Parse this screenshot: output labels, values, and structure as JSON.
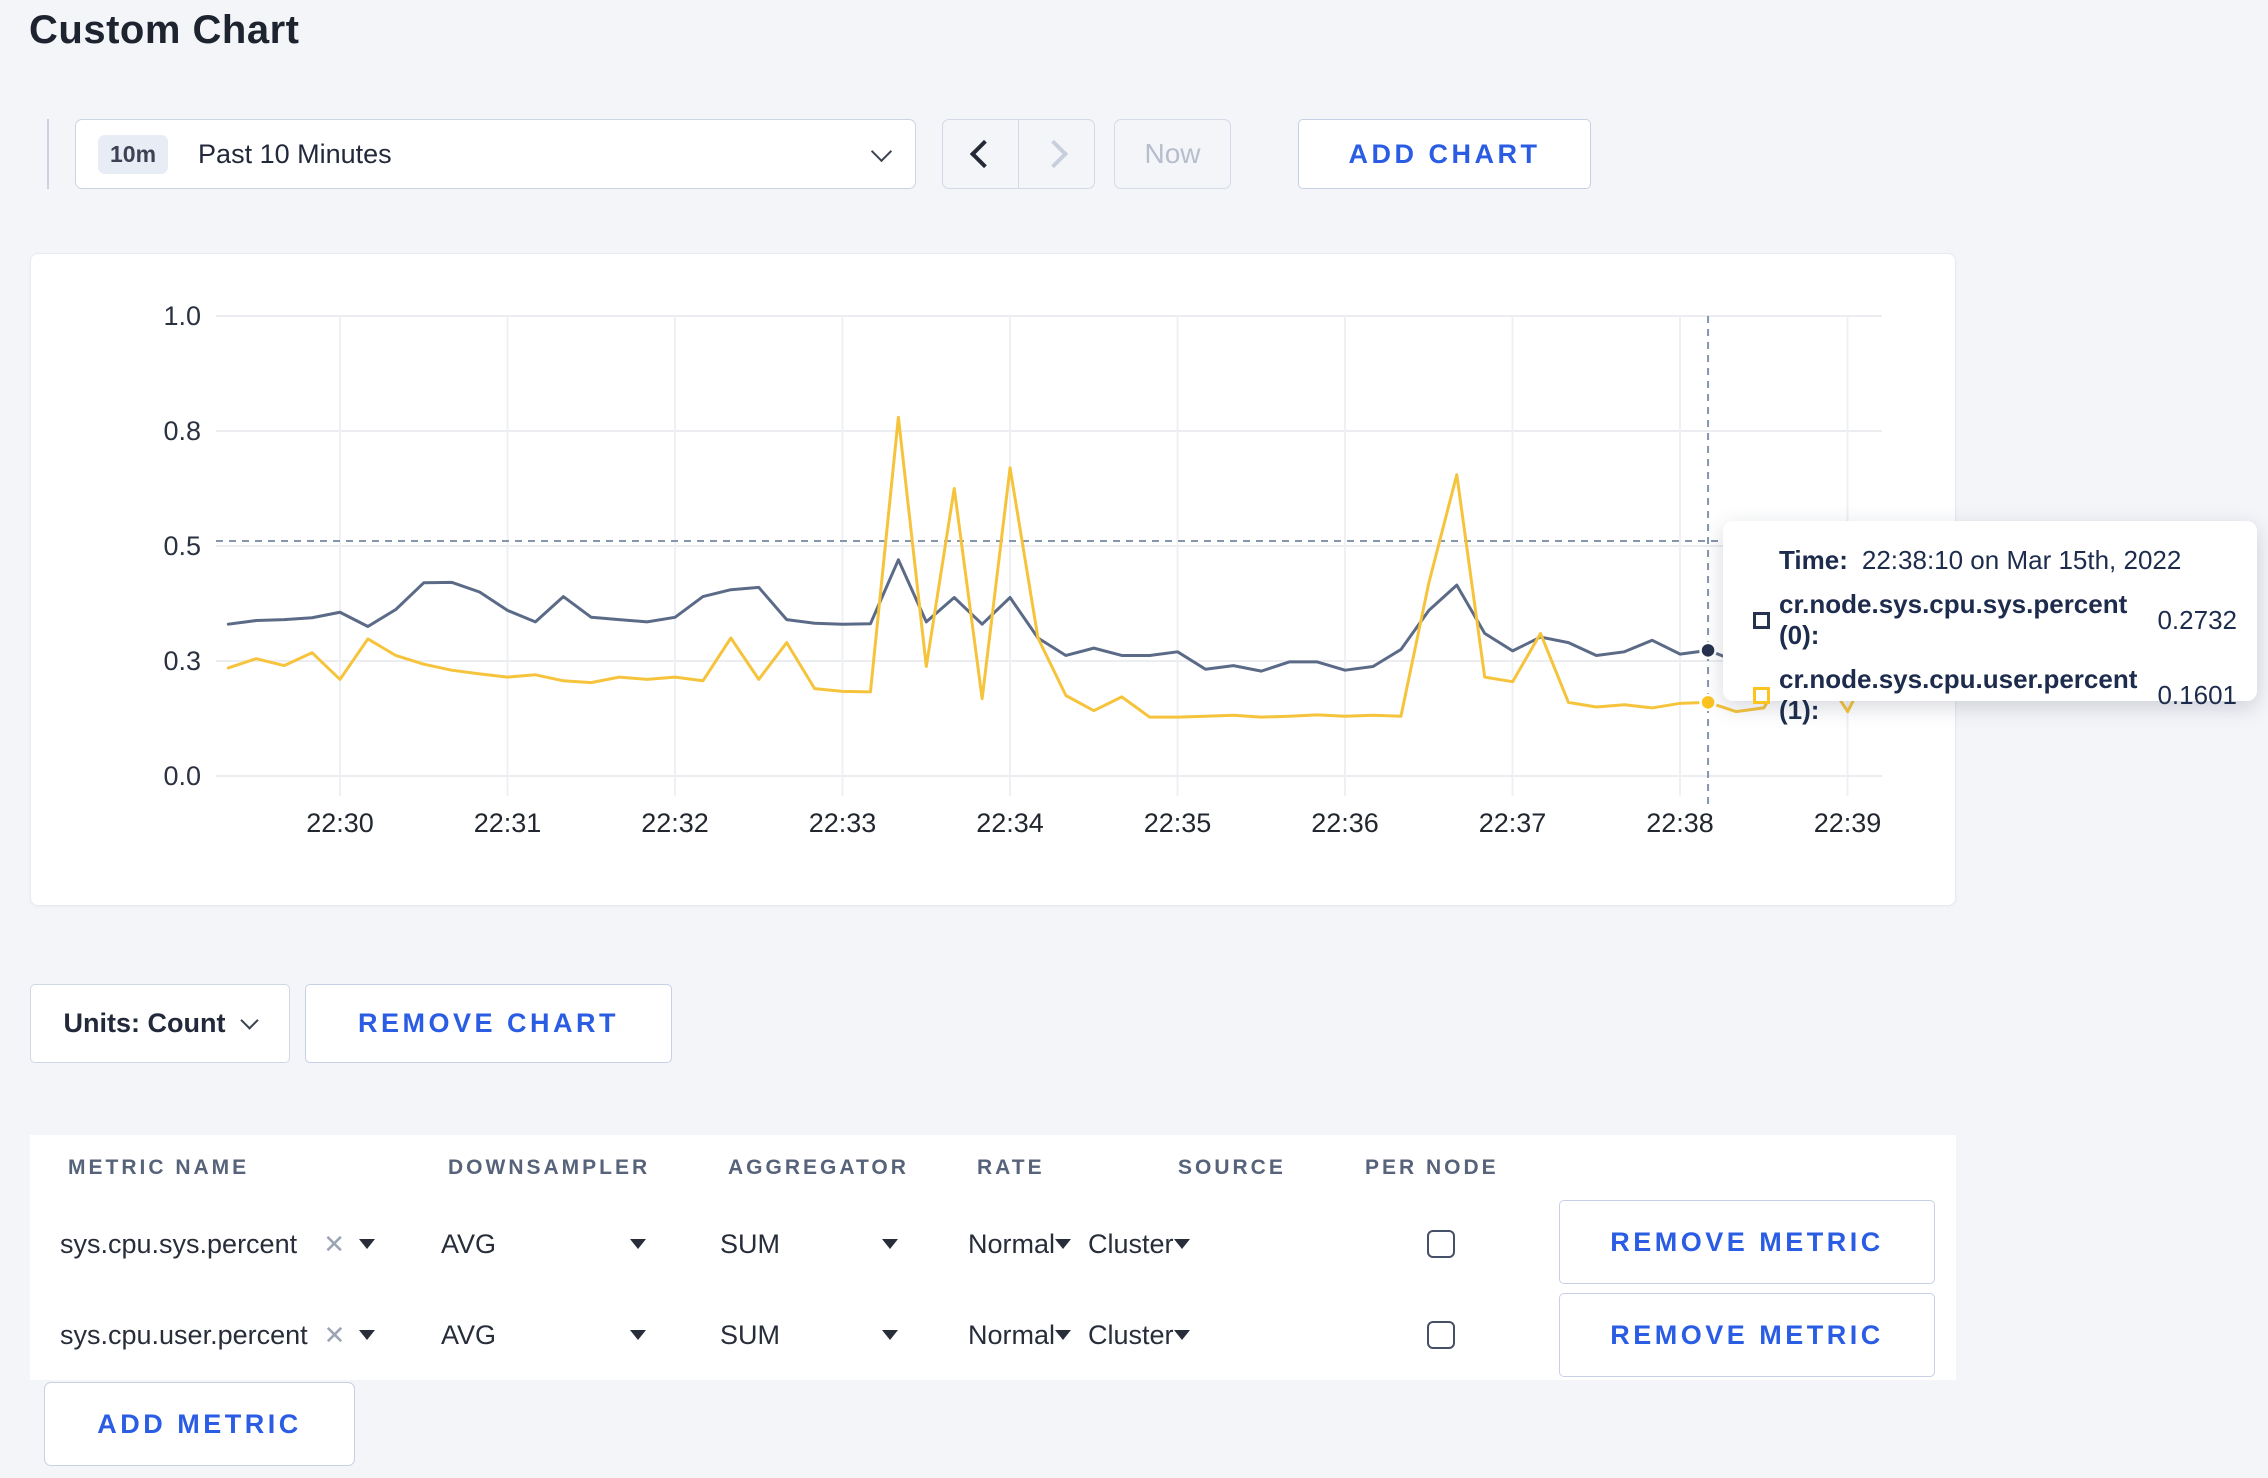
{
  "page": {
    "title": "Custom Chart",
    "background": "#f4f5f9"
  },
  "toolbar": {
    "time_range": {
      "badge": "10m",
      "label": "Past 10 Minutes"
    },
    "now_label": "Now",
    "add_chart_label": "ADD CHART"
  },
  "colors": {
    "accent_blue": "#2a5ce4",
    "series_sys_line": "#5b6b87",
    "series_user_line": "#f6c43c",
    "swatch_sys": "#26324e",
    "swatch_user": "#fcc321",
    "crosshair": "#8595ab",
    "grid": "#ebedf0",
    "axis_text": "#2a3140",
    "disabled_text": "#b6bdcc"
  },
  "chart_data": {
    "type": "line",
    "start_time": "22:29:20",
    "interval_seconds": 10,
    "grid": true,
    "legend": false,
    "x_axis": {
      "tick_labels": [
        "22:30",
        "22:31",
        "22:32",
        "22:33",
        "22:34",
        "22:35",
        "22:36",
        "22:37",
        "22:38",
        "22:39"
      ]
    },
    "y_axis": {
      "tick_labels": [
        "0.0",
        "0.3",
        "0.5",
        "0.8",
        "1.0"
      ],
      "tick_values": [
        0,
        0.25,
        0.5,
        0.75,
        1.0
      ],
      "range": [
        0,
        1
      ]
    },
    "crosshair": {
      "index": 53,
      "time": "22:38:10",
      "hline_value": 0.511
    },
    "series": [
      {
        "name": "cr.node.sys.cpu.sys.percent",
        "values": [
          0.33,
          0.338,
          0.34,
          0.344,
          0.356,
          0.325,
          0.362,
          0.42,
          0.421,
          0.4,
          0.36,
          0.335,
          0.39,
          0.345,
          0.34,
          0.335,
          0.345,
          0.39,
          0.405,
          0.41,
          0.34,
          0.332,
          0.33,
          0.331,
          0.47,
          0.335,
          0.388,
          0.33,
          0.388,
          0.3,
          0.262,
          0.278,
          0.262,
          0.262,
          0.27,
          0.232,
          0.24,
          0.228,
          0.248,
          0.248,
          0.23,
          0.238,
          0.275,
          0.36,
          0.415,
          0.31,
          0.272,
          0.302,
          0.29,
          0.262,
          0.27,
          0.295,
          0.265,
          0.2732,
          0.25,
          0.268,
          0.28,
          0.272,
          0.285,
          0.28
        ]
      },
      {
        "name": "cr.node.sys.cpu.user.percent",
        "values": [
          0.235,
          0.255,
          0.24,
          0.268,
          0.21,
          0.298,
          0.262,
          0.243,
          0.23,
          0.222,
          0.215,
          0.22,
          0.207,
          0.203,
          0.215,
          0.21,
          0.215,
          0.207,
          0.3,
          0.21,
          0.29,
          0.19,
          0.184,
          0.183,
          0.78,
          0.238,
          0.625,
          0.168,
          0.67,
          0.3,
          0.175,
          0.142,
          0.172,
          0.128,
          0.128,
          0.13,
          0.132,
          0.128,
          0.13,
          0.133,
          0.13,
          0.132,
          0.13,
          0.42,
          0.655,
          0.215,
          0.205,
          0.31,
          0.16,
          0.15,
          0.155,
          0.148,
          0.158,
          0.1601,
          0.14,
          0.148,
          0.255,
          0.235,
          0.14,
          0.26
        ]
      }
    ]
  },
  "tooltip": {
    "time_label": "Time:",
    "time_value": "22:38:10 on Mar 15th, 2022",
    "rows": [
      {
        "label": "cr.node.sys.cpu.sys.percent (0):",
        "value": "0.2732"
      },
      {
        "label": "cr.node.sys.cpu.user.percent (1):",
        "value": "0.1601"
      }
    ]
  },
  "controls": {
    "units_label": "Units: Count",
    "remove_chart_label": "REMOVE CHART",
    "add_metric_label": "ADD METRIC"
  },
  "table": {
    "headers": [
      "METRIC NAME",
      "DOWNSAMPLER",
      "AGGREGATOR",
      "RATE",
      "SOURCE",
      "PER NODE"
    ],
    "remove_metric_label": "REMOVE METRIC",
    "rows": [
      {
        "name": "sys.cpu.sys.percent",
        "downsampler": "AVG",
        "aggregator": "SUM",
        "rate": "Normal",
        "source": "Cluster",
        "per_node_checked": false
      },
      {
        "name": "sys.cpu.user.percent",
        "downsampler": "AVG",
        "aggregator": "SUM",
        "rate": "Normal",
        "source": "Cluster",
        "per_node_checked": false
      }
    ]
  }
}
